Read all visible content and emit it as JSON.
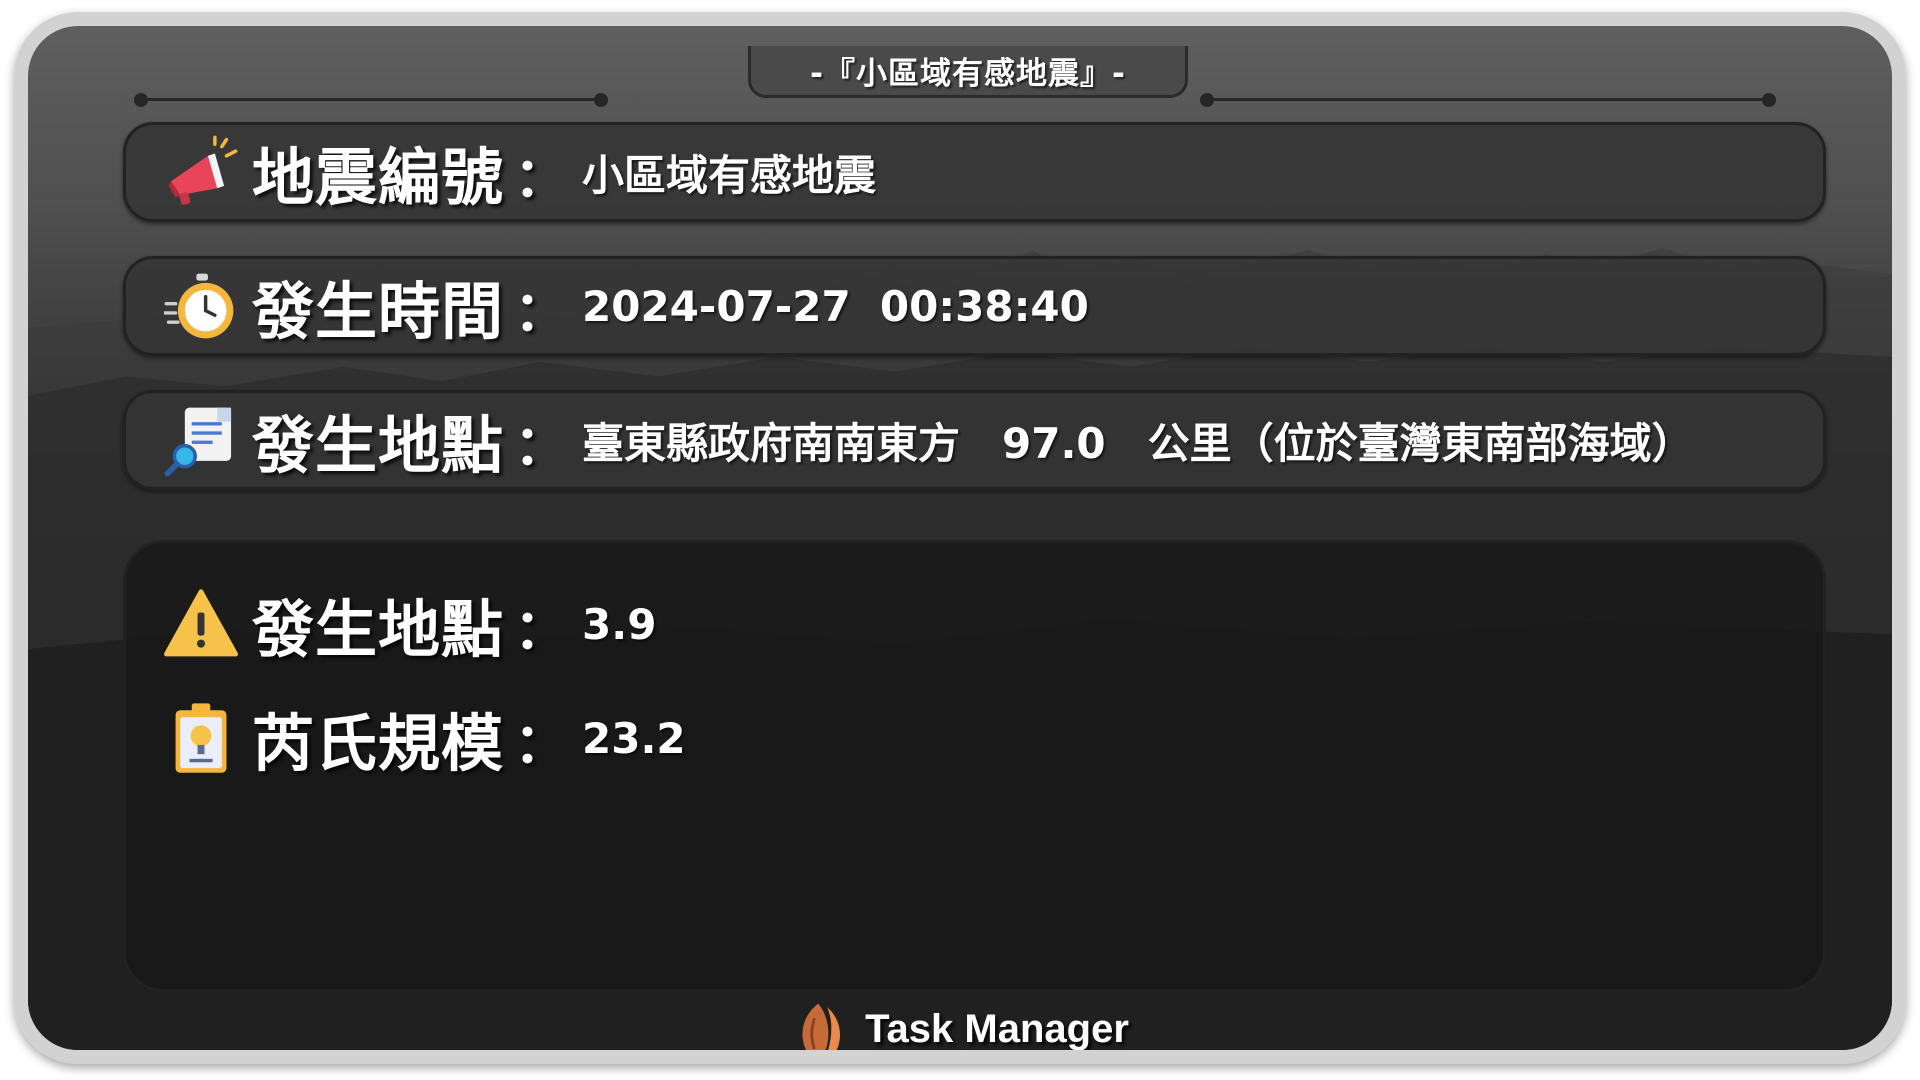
{
  "header": {
    "title": "-『小區域有感地震』-"
  },
  "rows": [
    {
      "icon": "megaphone-icon",
      "label": "地震編號",
      "colon": "：",
      "value": "小區域有感地震"
    },
    {
      "icon": "stopwatch-icon",
      "label": "發生時間",
      "colon": "：",
      "value": "2024-07-27  00:38:40"
    },
    {
      "icon": "document-search-icon",
      "label": "發生地點",
      "colon": "：",
      "value": "臺東縣政府南南東方　97.0　公里（位於臺灣東南部海域）"
    }
  ],
  "details": [
    {
      "icon": "warning-icon",
      "label": "發生地點",
      "colon": "：",
      "value": "3.9"
    },
    {
      "icon": "id-badge-icon",
      "label": "芮氏規模",
      "colon": "：",
      "value": "23.2"
    }
  ],
  "footer": {
    "logo_icon": "almond-logo-icon",
    "brand": "Task Manager"
  },
  "colors": {
    "card_border": "#d2d2d2",
    "panel_bg": "#343434",
    "text": "#ffffff"
  }
}
